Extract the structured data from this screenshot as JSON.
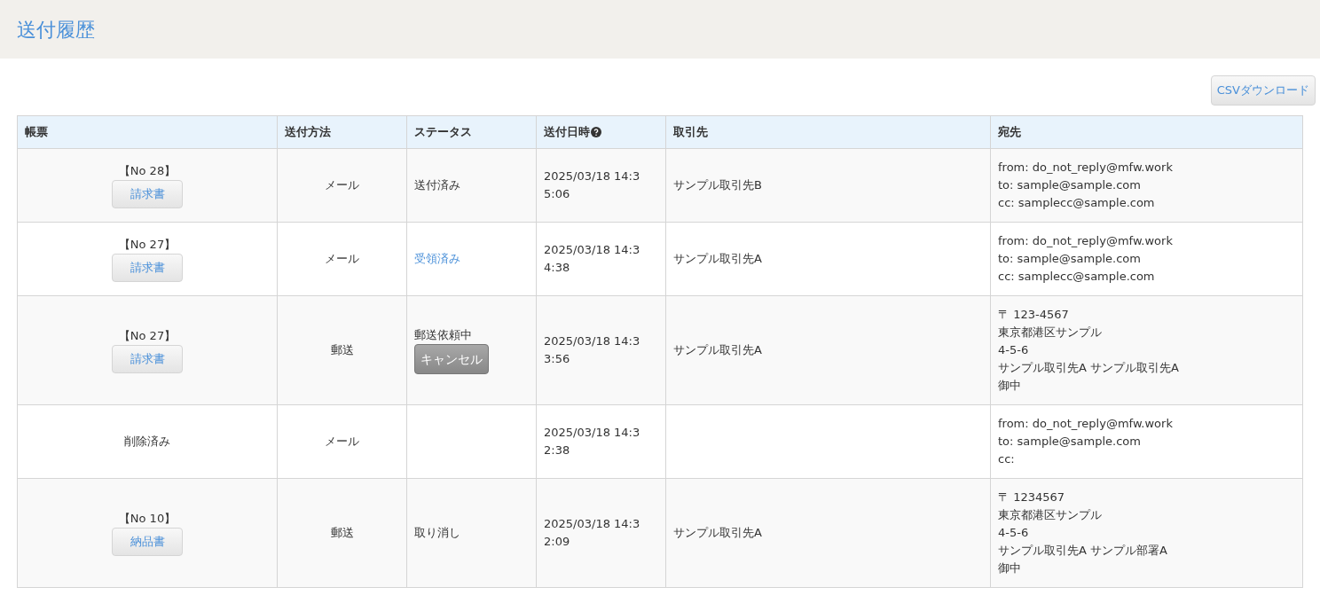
{
  "page_title": "送付履歴",
  "csv_button": "CSVダウンロード",
  "table": {
    "columns": [
      {
        "label": "帳票",
        "help": false
      },
      {
        "label": "送付方法",
        "help": false
      },
      {
        "label": "ステータス",
        "help": false
      },
      {
        "label": "送付日時",
        "help": true
      },
      {
        "label": "取引先",
        "help": false
      },
      {
        "label": "宛先",
        "help": false
      }
    ],
    "rows": [
      {
        "document": {
          "kind": "doc",
          "number": "【No 28】",
          "button": "請求書"
        },
        "method": "メール",
        "status": {
          "kind": "text",
          "label": "送付済み"
        },
        "sent_at": "2025/03/18 14:35:06",
        "partner": "サンプル取引先B",
        "recipient": [
          "from: do_not_reply@mfw.work",
          "to: sample@sample.com",
          "cc: samplecc@sample.com"
        ]
      },
      {
        "document": {
          "kind": "doc",
          "number": "【No 27】",
          "button": "請求書"
        },
        "method": "メール",
        "status": {
          "kind": "link",
          "label": "受領済み"
        },
        "sent_at": "2025/03/18 14:34:38",
        "partner": "サンプル取引先A",
        "recipient": [
          "from: do_not_reply@mfw.work",
          "to: sample@sample.com",
          "cc: samplecc@sample.com"
        ]
      },
      {
        "document": {
          "kind": "doc",
          "number": "【No 27】",
          "button": "請求書"
        },
        "method": "郵送",
        "status": {
          "kind": "cancelable",
          "label": "郵送依頼中",
          "button": "キャンセル"
        },
        "sent_at": "2025/03/18 14:33:56",
        "partner": "サンプル取引先A",
        "recipient": [
          "〒 123-4567",
          "東京都港区サンプル",
          "4-5-6",
          "サンプル取引先A サンプル取引先A",
          "御中"
        ]
      },
      {
        "document": {
          "kind": "deleted",
          "label": "削除済み"
        },
        "method": "メール",
        "sent_at": "2025/03/18 14:32:38",
        "recipient": [
          "from: do_not_reply@mfw.work",
          "to: sample@sample.com",
          "cc:"
        ]
      },
      {
        "document": {
          "kind": "doc",
          "number": "【No 10】",
          "button": "納品書"
        },
        "method": "郵送",
        "status": {
          "kind": "text",
          "label": "取り消し"
        },
        "sent_at": "2025/03/18 14:32:09",
        "partner": "サンプル取引先A",
        "recipient": [
          "〒 1234567",
          "東京都港区サンプル",
          "4-5-6",
          "サンプル取引先A サンプル部署A",
          "御中"
        ]
      }
    ]
  }
}
